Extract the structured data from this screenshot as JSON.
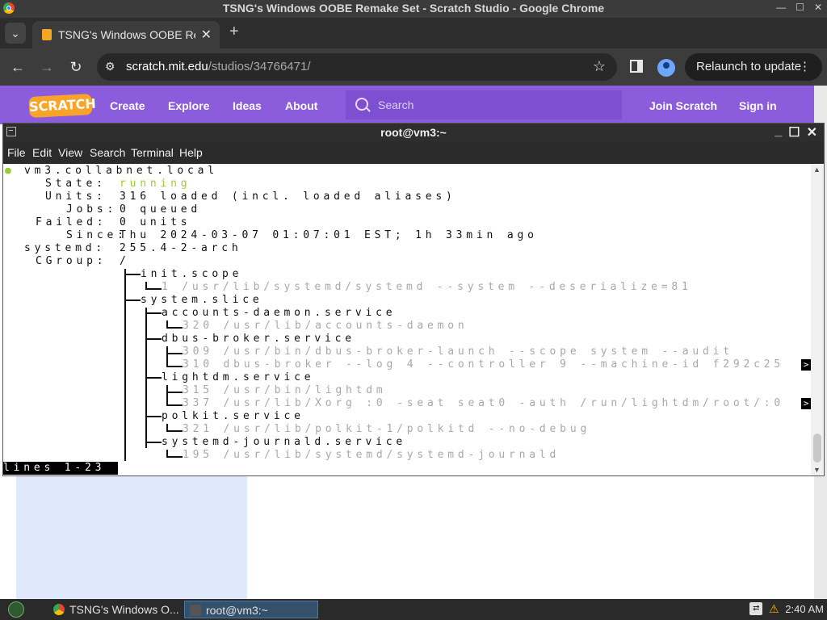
{
  "chrome": {
    "window_title": "TSNG's Windows OOBE Remake Set - Scratch Studio - Google Chrome",
    "tab_label": "TSNG's Windows OOBE Rem",
    "url_host": "scratch.mit.edu",
    "url_path": "/studios/34766471/",
    "relaunch_label": "Relaunch to update"
  },
  "scratch": {
    "logo": "SCRATCH",
    "nav": [
      "Create",
      "Explore",
      "Ideas",
      "About"
    ],
    "search_placeholder": "Search",
    "join": "Join Scratch",
    "signin": "Sign in"
  },
  "terminal": {
    "title": "root@vm3:~",
    "menu": [
      "File",
      "Edit",
      "View",
      "Search",
      "Terminal",
      "Help"
    ],
    "lines": [
      {
        "text": "vm3.collabnet.local",
        "kind": "normal"
      },
      {
        "key": "State:",
        "value": "running",
        "kind": "state"
      },
      {
        "key": "Units:",
        "value": "316 loaded (incl. loaded aliases)",
        "kind": "kv"
      },
      {
        "key": "Jobs:",
        "value": "0 queued",
        "kind": "kv"
      },
      {
        "key": "Failed:",
        "value": "0 units",
        "kind": "kv"
      },
      {
        "key": "Since:",
        "value": "Thu 2024-03-07 01:07:01 EST; 1h 33min ago",
        "kind": "kv"
      },
      {
        "key": "systemd:",
        "value": "255.4-2-arch",
        "kind": "kv"
      },
      {
        "key": "CGroup:",
        "value": "/",
        "kind": "kv"
      },
      {
        "text": "init.scope",
        "kind": "tree"
      },
      {
        "text": "1 /usr/lib/systemd/systemd --system --deserialize=81",
        "kind": "proc"
      },
      {
        "text": "system.slice",
        "kind": "tree"
      },
      {
        "text": "accounts-daemon.service",
        "kind": "tree"
      },
      {
        "text": "320 /usr/lib/accounts-daemon",
        "kind": "proc"
      },
      {
        "text": "dbus-broker.service",
        "kind": "tree"
      },
      {
        "text": "309 /usr/bin/dbus-broker-launch --scope system --audit",
        "kind": "proc"
      },
      {
        "text": "310 dbus-broker --log 4 --controller 9 --machine-id f292c25",
        "kind": "proc"
      },
      {
        "text": "lightdm.service",
        "kind": "tree"
      },
      {
        "text": "315 /usr/bin/lightdm",
        "kind": "proc"
      },
      {
        "text": "337 /usr/lib/Xorg :0 -seat seat0 -auth /run/lightdm/root/:0",
        "kind": "proc"
      },
      {
        "text": "polkit.service",
        "kind": "tree"
      },
      {
        "text": "321 /usr/lib/polkit-1/polkitd --no-debug",
        "kind": "proc"
      },
      {
        "text": "systemd-journald.service",
        "kind": "tree"
      },
      {
        "text": "195 /usr/lib/systemd/systemd-journald",
        "kind": "proc"
      }
    ],
    "status_line": "lines 1-23",
    "overflow_marker": ">"
  },
  "taskbar": {
    "items": [
      "TSNG's Windows O...",
      "root@vm3:~"
    ],
    "clock": "2:40 AM"
  }
}
